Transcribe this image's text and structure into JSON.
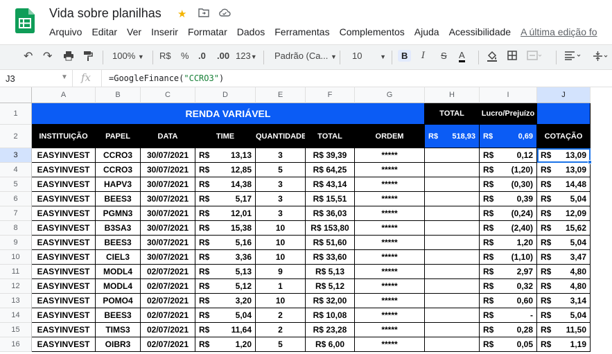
{
  "app": {
    "doc_title": "Vida sobre planilhas",
    "menu": [
      "Arquivo",
      "Editar",
      "Ver",
      "Inserir",
      "Formatar",
      "Dados",
      "Ferramentas",
      "Complementos",
      "Ajuda",
      "Acessibilidade"
    ],
    "last_edit": "A última edição fo"
  },
  "toolbar": {
    "zoom": "100%",
    "currency": "R$",
    "percent": "%",
    "dec_less": ".0",
    "dec_more": ".00",
    "format_more": "123",
    "font": "Padrão (Ca...",
    "font_size": "10",
    "bold": "B",
    "italic": "I",
    "strike": "S",
    "text_color": "A"
  },
  "formula_bar": {
    "name_box": "J3",
    "fx": "fx",
    "formula_prefix": "=GoogleFinance(",
    "formula_string": "\"CCRO3\"",
    "formula_suffix": ")"
  },
  "columns": [
    "A",
    "B",
    "C",
    "D",
    "E",
    "F",
    "G",
    "H",
    "I",
    "J"
  ],
  "selected_col": "J",
  "selected_row": "3",
  "rows": [
    "1",
    "2",
    "3",
    "4",
    "5",
    "6",
    "7",
    "8",
    "9",
    "10",
    "11",
    "12",
    "13",
    "14",
    "15",
    "16"
  ],
  "sheet": {
    "banner": "RENDA VARIÁVEL",
    "total_label": "TOTAL",
    "lucro_label": "Lucro/Prejuízo",
    "headers": [
      "INSTITUIÇÃO",
      "PAPEL",
      "DATA",
      "TIME",
      "QUANTIDADE",
      "TOTAL",
      "ORDEM"
    ],
    "total_cur": "R$",
    "total_val": "518,93",
    "lucro_cur": "R$",
    "lucro_val": "0,69",
    "cotacao_label": "COTAÇÃO",
    "data_rows": [
      {
        "inst": "EASYINVEST",
        "papel": "CCRO3",
        "data": "30/07/2021",
        "time": "13,13",
        "qtd": "3",
        "total": "R$ 39,39",
        "ordem": "*****",
        "lucro": "0,12",
        "cot": "13,09"
      },
      {
        "inst": "EASYINVEST",
        "papel": "CCRO3",
        "data": "30/07/2021",
        "time": "12,85",
        "qtd": "5",
        "total": "R$ 64,25",
        "ordem": "*****",
        "lucro": "(1,20)",
        "cot": "13,09"
      },
      {
        "inst": "EASYINVEST",
        "papel": "HAPV3",
        "data": "30/07/2021",
        "time": "14,38",
        "qtd": "3",
        "total": "R$ 43,14",
        "ordem": "*****",
        "lucro": "(0,30)",
        "cot": "14,48"
      },
      {
        "inst": "EASYINVEST",
        "papel": "BEES3",
        "data": "30/07/2021",
        "time": "5,17",
        "qtd": "3",
        "total": "R$ 15,51",
        "ordem": "*****",
        "lucro": "0,39",
        "cot": "5,04"
      },
      {
        "inst": "EASYINVEST",
        "papel": "PGMN3",
        "data": "30/07/2021",
        "time": "12,01",
        "qtd": "3",
        "total": "R$ 36,03",
        "ordem": "*****",
        "lucro": "(0,24)",
        "cot": "12,09"
      },
      {
        "inst": "EASYINVEST",
        "papel": "B3SA3",
        "data": "30/07/2021",
        "time": "15,38",
        "qtd": "10",
        "total": "R$ 153,80",
        "ordem": "*****",
        "lucro": "(2,40)",
        "cot": "15,62"
      },
      {
        "inst": "EASYINVEST",
        "papel": "BEES3",
        "data": "30/07/2021",
        "time": "5,16",
        "qtd": "10",
        "total": "R$ 51,60",
        "ordem": "*****",
        "lucro": "1,20",
        "cot": "5,04"
      },
      {
        "inst": "EASYINVEST",
        "papel": "CIEL3",
        "data": "30/07/2021",
        "time": "3,36",
        "qtd": "10",
        "total": "R$ 33,60",
        "ordem": "*****",
        "lucro": "(1,10)",
        "cot": "3,47"
      },
      {
        "inst": "EASYINVEST",
        "papel": "MODL4",
        "data": "02/07/2021",
        "time": "5,13",
        "qtd": "9",
        "total": "R$ 5,13",
        "ordem": "*****",
        "lucro": "2,97",
        "cot": "4,80"
      },
      {
        "inst": "EASYINVEST",
        "papel": "MODL4",
        "data": "02/07/2021",
        "time": "5,12",
        "qtd": "1",
        "total": "R$ 5,12",
        "ordem": "*****",
        "lucro": "0,32",
        "cot": "4,80"
      },
      {
        "inst": "EASYINVEST",
        "papel": "POMO4",
        "data": "02/07/2021",
        "time": "3,20",
        "qtd": "10",
        "total": "R$ 32,00",
        "ordem": "*****",
        "lucro": "0,60",
        "cot": "3,14"
      },
      {
        "inst": "EASYINVEST",
        "papel": "BEES3",
        "data": "02/07/2021",
        "time": "5,04",
        "qtd": "2",
        "total": "R$ 10,08",
        "ordem": "*****",
        "lucro": "-",
        "cot": "5,04"
      },
      {
        "inst": "EASYINVEST",
        "papel": "TIMS3",
        "data": "02/07/2021",
        "time": "11,64",
        "qtd": "2",
        "total": "R$ 23,28",
        "ordem": "*****",
        "lucro": "0,28",
        "cot": "11,50"
      },
      {
        "inst": "EASYINVEST",
        "papel": "OIBR3",
        "data": "02/07/2021",
        "time": "1,20",
        "qtd": "5",
        "total": "R$ 6,00",
        "ordem": "*****",
        "lucro": "0,05",
        "cot": "1,19"
      }
    ],
    "currency": "R$"
  },
  "colors": {
    "banner_blue": "#0b5cf5",
    "header_black": "#000000",
    "selection": "#1a73e8"
  }
}
